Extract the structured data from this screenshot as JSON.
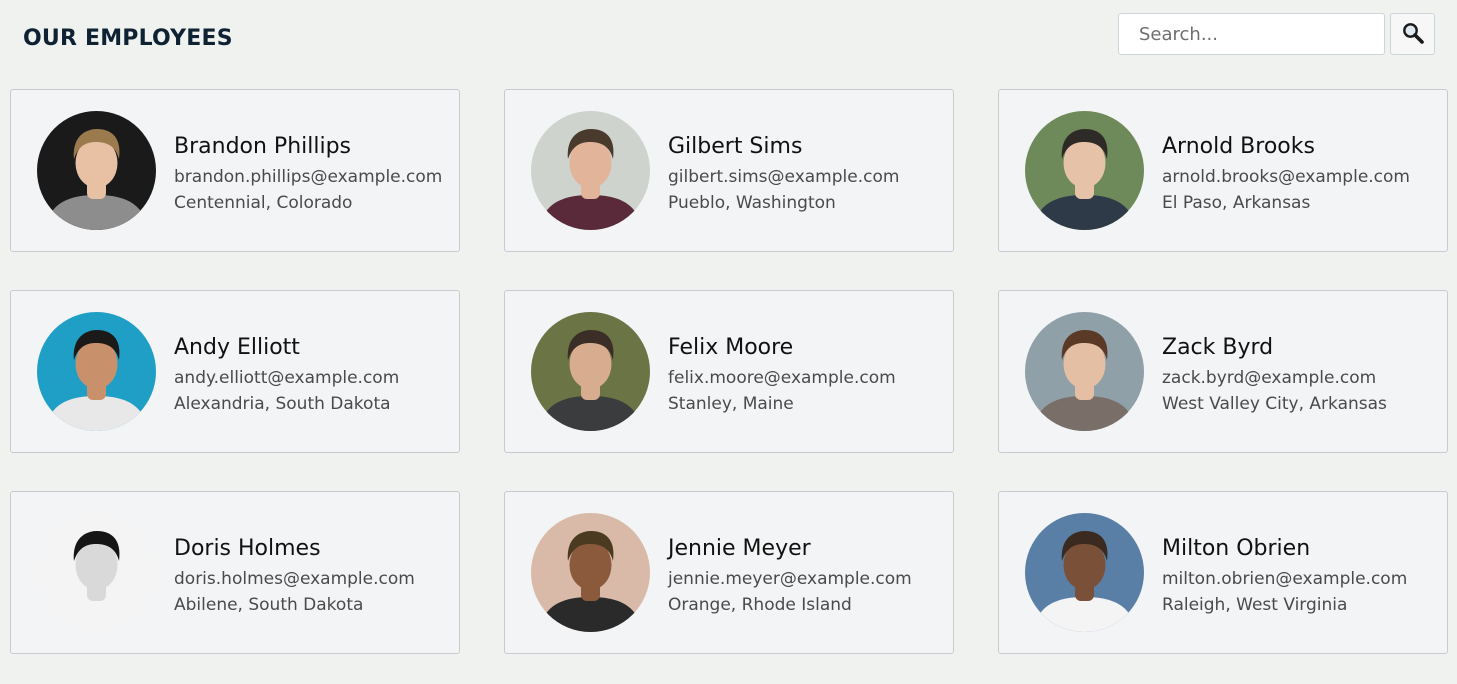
{
  "header": {
    "title": "OUR EMPLOYEES"
  },
  "search": {
    "placeholder": "Search...",
    "value": "",
    "button_icon": "search-icon"
  },
  "employees": [
    {
      "name": "Brandon Phillips",
      "email": "brandon.phillips@example.com",
      "location": "Centennial, Colorado",
      "avatar_bg": "#1a1a1a",
      "hair": "#9b7a4e",
      "skin": "#e8c0a3",
      "shirt": "#8d8d8d"
    },
    {
      "name": "Gilbert Sims",
      "email": "gilbert.sims@example.com",
      "location": "Pueblo, Washington",
      "avatar_bg": "#cfd3cd",
      "hair": "#4a3a2e",
      "skin": "#e2b49a",
      "shirt": "#5a2a3a"
    },
    {
      "name": "Arnold Brooks",
      "email": "arnold.brooks@example.com",
      "location": "El Paso, Arkansas",
      "avatar_bg": "#6f8a5a",
      "hair": "#2e2a27",
      "skin": "#e6c2a8",
      "shirt": "#2f3a48"
    },
    {
      "name": "Andy Elliott",
      "email": "andy.elliott@example.com",
      "location": "Alexandria, South Dakota",
      "avatar_bg": "#1f9fc6",
      "hair": "#1c1a19",
      "skin": "#c8916c",
      "shirt": "#e8e8e8"
    },
    {
      "name": "Felix Moore",
      "email": "felix.moore@example.com",
      "location": "Stanley, Maine",
      "avatar_bg": "#6b7445",
      "hair": "#3a2e26",
      "skin": "#d8ac8e",
      "shirt": "#3a3c3e"
    },
    {
      "name": "Zack Byrd",
      "email": "zack.byrd@example.com",
      "location": "West Valley City, Arkansas",
      "avatar_bg": "#8fa0a8",
      "hair": "#5a3a26",
      "skin": "#e4bfa3",
      "shirt": "#7a6e68"
    },
    {
      "name": "Doris Holmes",
      "email": "doris.holmes@example.com",
      "location": "Abilene, South Dakota",
      "avatar_bg": "#f4f4f4",
      "hair": "#151515",
      "skin": "#d9d9d9",
      "shirt": "#f4f4f4"
    },
    {
      "name": "Jennie Meyer",
      "email": "jennie.meyer@example.com",
      "location": "Orange, Rhode Island",
      "avatar_bg": "#d9b9a8",
      "hair": "#4a3a20",
      "skin": "#8b5a3c",
      "shirt": "#2a2a2a"
    },
    {
      "name": "Milton Obrien",
      "email": "milton.obrien@example.com",
      "location": "Raleigh, West Virginia",
      "avatar_bg": "#5a7fa6",
      "hair": "#3a2a20",
      "skin": "#7a5038",
      "shirt": "#f4f4f4"
    }
  ]
}
